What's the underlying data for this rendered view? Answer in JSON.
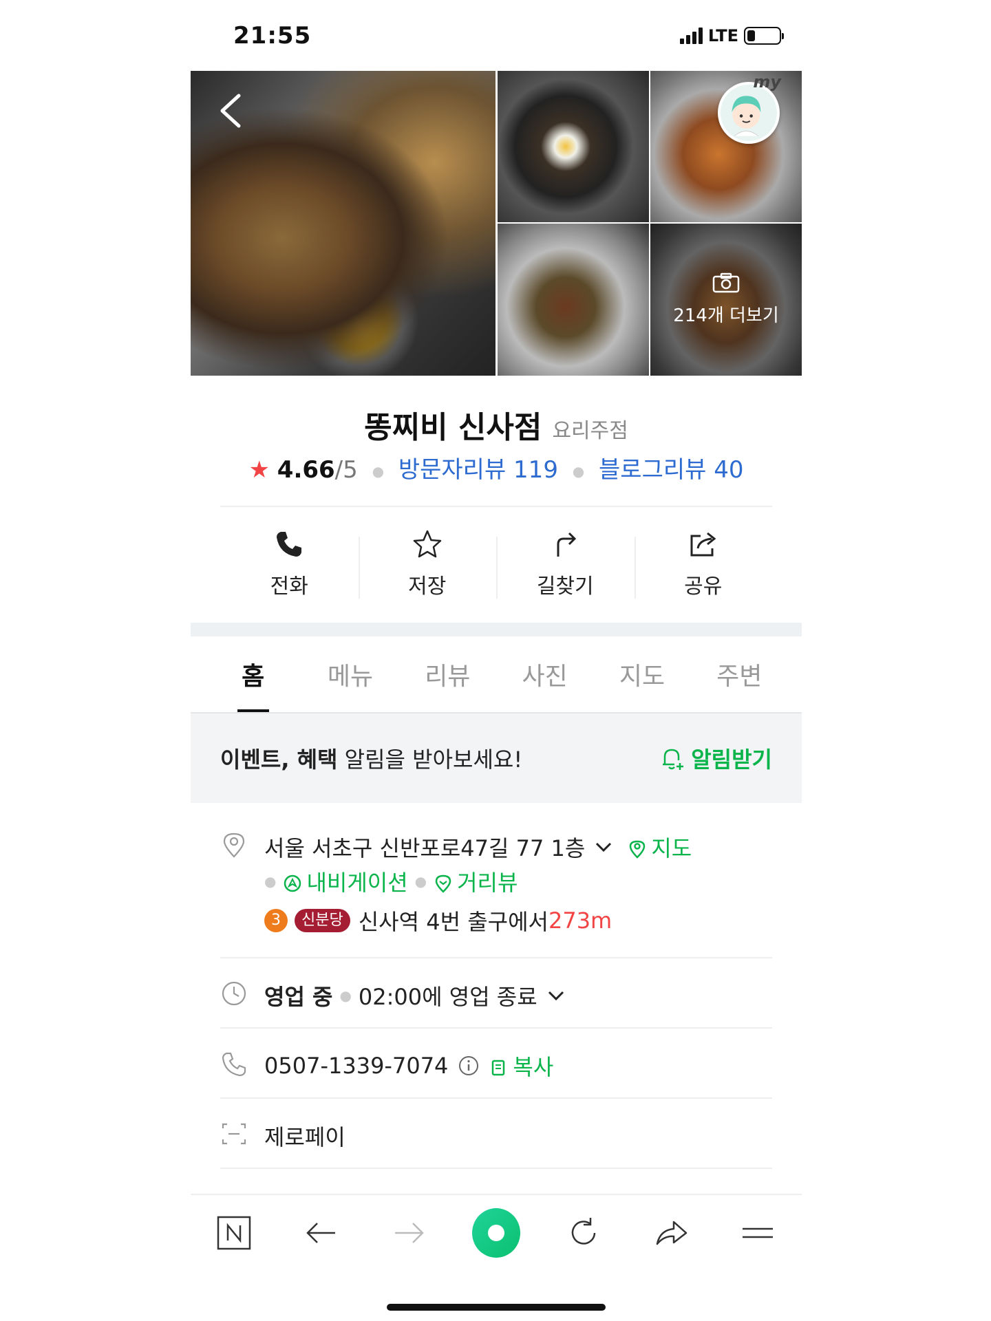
{
  "status_bar": {
    "time": "21:55",
    "network": "LTE",
    "battery_level": 0.25
  },
  "photos": {
    "more_label": "214개 더보기",
    "my_badge_text": "my"
  },
  "place": {
    "name": "똥찌비 신사점",
    "category": "요리주점",
    "rating": "4.66",
    "rating_max": "/5",
    "visitor_reviews": "방문자리뷰 119",
    "blog_reviews": "블로그리뷰 40"
  },
  "actions": [
    {
      "label": "전화",
      "icon": "phone-icon"
    },
    {
      "label": "저장",
      "icon": "star-icon"
    },
    {
      "label": "길찾기",
      "icon": "directions-icon"
    },
    {
      "label": "공유",
      "icon": "share-icon"
    }
  ],
  "tabs": [
    "홈",
    "메뉴",
    "리뷰",
    "사진",
    "지도",
    "주변"
  ],
  "active_tab": "홈",
  "notice": {
    "bold": "이벤트, 혜택",
    "text": " 알림을 받아보세요!",
    "button": "알림받기"
  },
  "address": {
    "text": "서울 서초구 신반포로47길 77 1층",
    "map_link": "지도",
    "navigation_link": "내비게이션",
    "streetview_link": "거리뷰",
    "line_number": "3",
    "line_name": "신분당",
    "exit_text": "신사역 4번 출구에서 ",
    "distance": "273m"
  },
  "hours": {
    "status": "영업 중",
    "detail": "02:00에 영업 종료"
  },
  "phone": {
    "number": "0507-1339-7074",
    "copy": "복사"
  },
  "payment": {
    "text": "제로페이"
  },
  "colors": {
    "accent_green": "#09b44a",
    "link_blue": "#2d6bd1",
    "star_red": "#f24444",
    "line3_orange": "#ef7c1c",
    "sinbundang_red": "#a41d32"
  }
}
